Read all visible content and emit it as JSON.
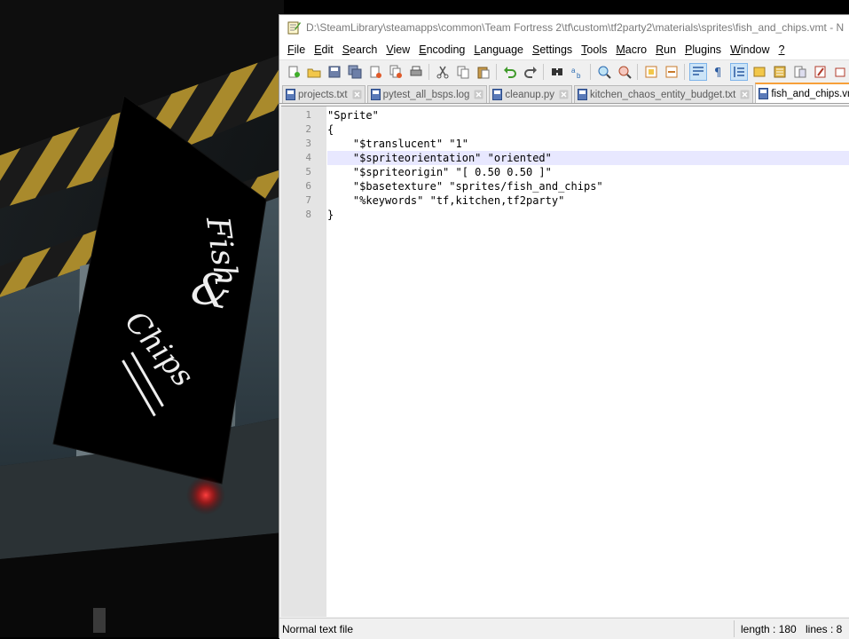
{
  "window": {
    "title": "D:\\SteamLibrary\\steamapps\\common\\Team Fortress 2\\tf\\custom\\tf2party2\\materials\\sprites\\fish_and_chips.vmt - N"
  },
  "menu": [
    {
      "ul": "F",
      "rest": "ile"
    },
    {
      "ul": "E",
      "rest": "dit"
    },
    {
      "ul": "S",
      "rest": "earch"
    },
    {
      "ul": "V",
      "rest": "iew"
    },
    {
      "ul": "E",
      "rest": "ncoding"
    },
    {
      "ul": "L",
      "rest": "anguage"
    },
    {
      "ul": "S",
      "rest": "ettings"
    },
    {
      "ul": "T",
      "rest": "ools"
    },
    {
      "ul": "M",
      "rest": "acro"
    },
    {
      "ul": "R",
      "rest": "un"
    },
    {
      "ul": "P",
      "rest": "lugins"
    },
    {
      "ul": "W",
      "rest": "indow"
    },
    {
      "ul": "?",
      "rest": ""
    }
  ],
  "tabs": [
    {
      "label": "projects.txt"
    },
    {
      "label": "pytest_all_bsps.log"
    },
    {
      "label": "cleanup.py"
    },
    {
      "label": "kitchen_chaos_entity_budget.txt"
    },
    {
      "label": "fish_and_chips.vmt"
    }
  ],
  "editor": {
    "line_numbers": [
      "1",
      "2",
      "3",
      "4",
      "5",
      "6",
      "7",
      "8"
    ],
    "lines": [
      "\"Sprite\"",
      "{",
      "    \"$translucent\" \"1\"",
      "    \"$spriteorientation\" \"oriented\"",
      "    \"$spriteorigin\" \"[ 0.50 0.50 ]\"",
      "    \"$basetexture\" \"sprites/fish_and_chips\"",
      "    \"%keywords\" \"tf,kitchen,tf2party\"",
      "}"
    ],
    "current_line": 4
  },
  "status": {
    "file_type": "Normal text file",
    "length": "length : 180",
    "lines": "lines : 8"
  },
  "sign": {
    "line1": "Fish",
    "line2": "&",
    "line3": "Chips"
  },
  "colors": {
    "accent_tab": "#f7a03a",
    "current_line": "#e8e8ff",
    "gutter": "#e4e4e4",
    "hazard_yellow": "#a98a2c"
  }
}
